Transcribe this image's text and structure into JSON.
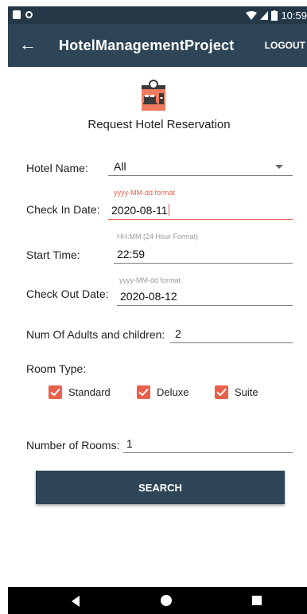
{
  "status_bar": {
    "time": "10:59"
  },
  "app_bar": {
    "title": "HotelManagementProject",
    "logout_label": "LOGOUT"
  },
  "page": {
    "title": "Request Hotel Reservation"
  },
  "hotel": {
    "label": "Hotel Name:",
    "value": "All"
  },
  "check_in": {
    "hint": "yyyy-MM-dd format",
    "label": "Check In Date:",
    "value": "2020-08-11"
  },
  "start_time": {
    "hint": "HH:MM (24 Hour Format)",
    "label": "Start Time:",
    "value": "22:59"
  },
  "check_out": {
    "hint": "yyyy-MM-dd format",
    "label": "Check Out Date:",
    "value": "2020-08-12"
  },
  "adults": {
    "label": "Num Of Adults and children:",
    "value": "2"
  },
  "room_type": {
    "label": "Room Type:",
    "options": [
      {
        "label": "Standard",
        "checked": true
      },
      {
        "label": "Deluxe",
        "checked": true
      },
      {
        "label": "Suite",
        "checked": true
      }
    ]
  },
  "rooms": {
    "label": "Number of Rooms:",
    "value": "1"
  },
  "search_label": "SEARCH",
  "colors": {
    "app_bar": "#2d4556",
    "status_bar": "#253848",
    "accent": "#e8604c"
  },
  "icons": [
    "back-arrow-icon",
    "hotel-logo-icon",
    "dropdown-arrow-icon",
    "checkbox-checked-icon",
    "nav-back-icon",
    "nav-home-icon",
    "nav-recents-icon"
  ]
}
